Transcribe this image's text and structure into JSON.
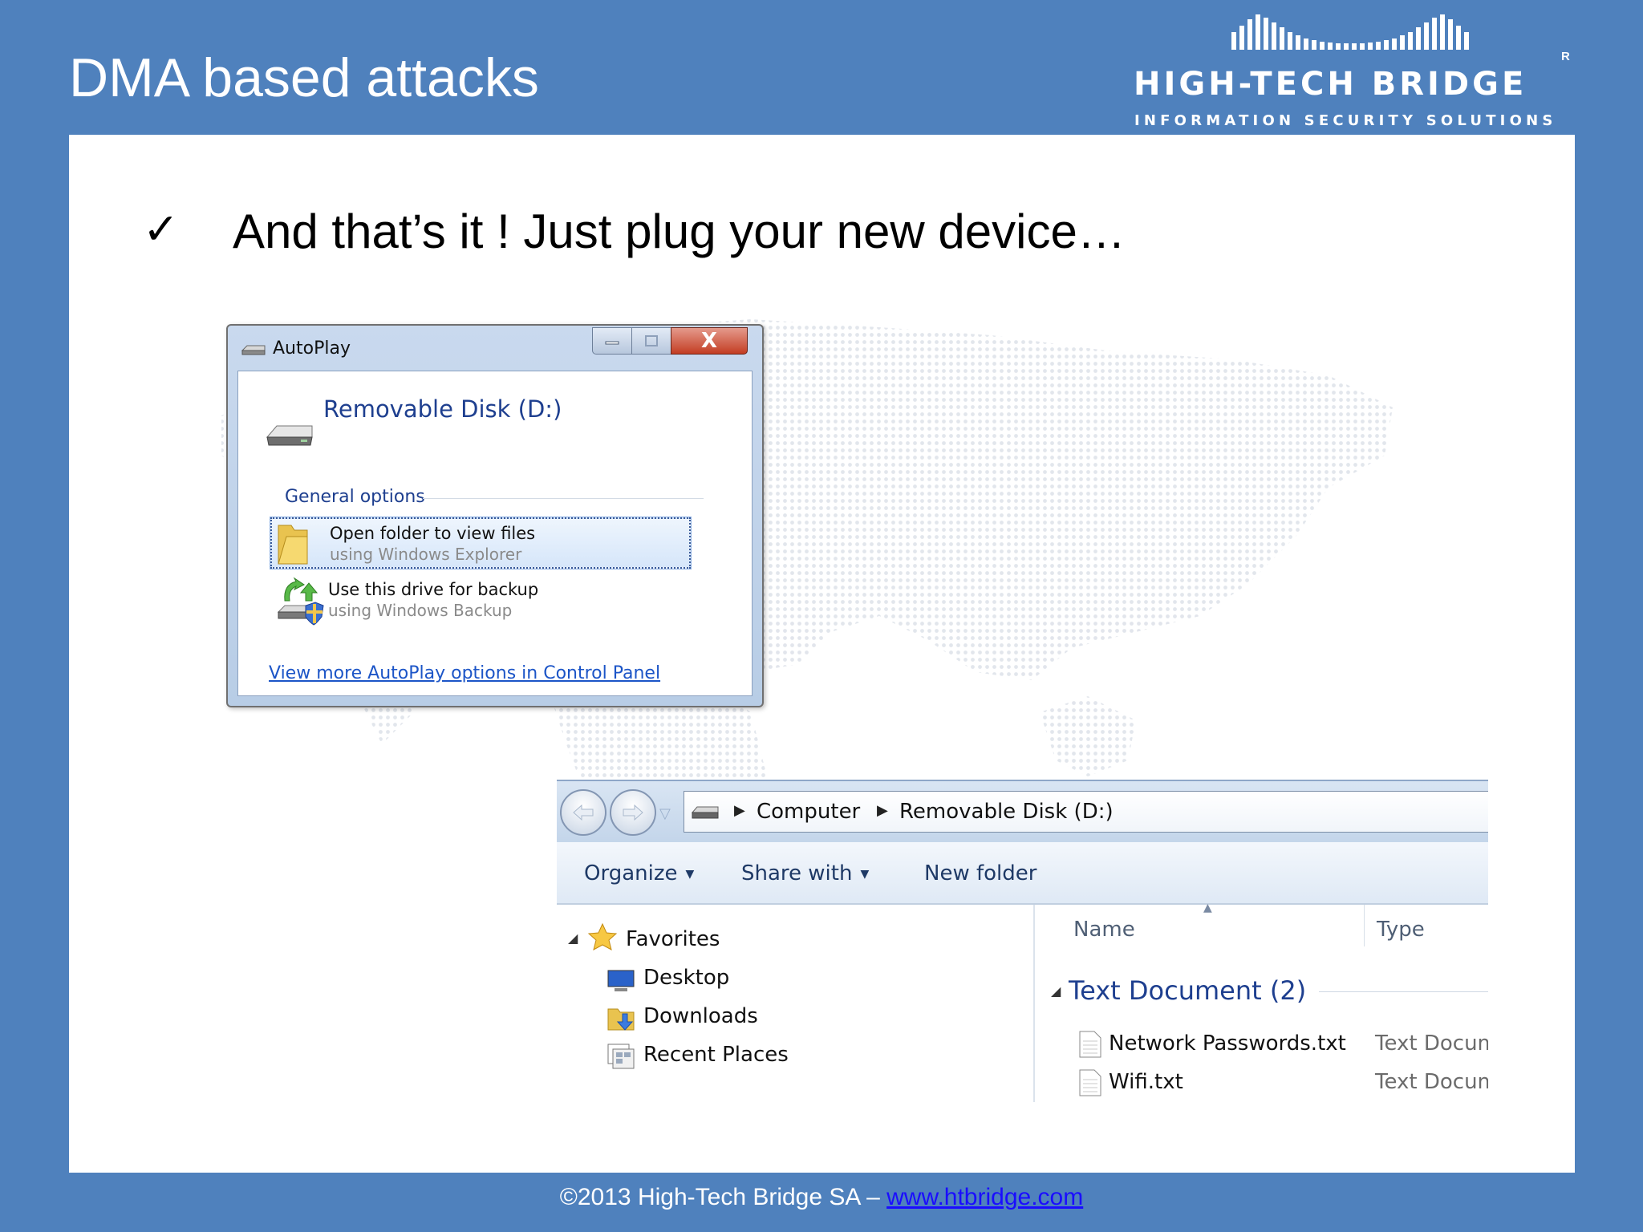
{
  "slide": {
    "title": "DMA based attacks",
    "bullet_mark": "✓",
    "bullet_text": "And that’s it ! Just plug your new device…"
  },
  "logo": {
    "name": "HIGH-TECH BRIDGE",
    "registered": "R",
    "tagline": "INFORMATION SECURITY SOLUTIONS"
  },
  "autoplay": {
    "title": "AutoPlay",
    "close_glyph": "X",
    "device": "Removable Disk (D:)",
    "section": "General options",
    "options": [
      {
        "main": "Open folder to view files",
        "sub": "using Windows Explorer",
        "selected": true,
        "icon": "folder-icon"
      },
      {
        "main": "Use this drive for backup",
        "sub": "using Windows Backup",
        "selected": false,
        "icon": "backup-icon"
      }
    ],
    "link": "View more AutoPlay options in Control Panel"
  },
  "explorer": {
    "breadcrumbs": [
      "Computer",
      "Removable Disk (D:)"
    ],
    "toolbar": {
      "organize": "Organize",
      "share": "Share with",
      "new_folder": "New folder"
    },
    "nav": {
      "favorites": "Favorites",
      "items": [
        "Desktop",
        "Downloads",
        "Recent Places"
      ]
    },
    "columns": {
      "name": "Name",
      "type": "Type"
    },
    "group": "Text Document (2)",
    "files": [
      {
        "name": "Network Passwords.txt",
        "type": "Text Document"
      },
      {
        "name": "Wifi.txt",
        "type": "Text Document"
      }
    ]
  },
  "footer": {
    "text": "©2013 High-Tech Bridge SA – ",
    "link": "www.htbridge.com"
  },
  "colors": {
    "slide_bg": "#4f81bd",
    "link_blue": "#1c55c7",
    "heading_blue": "#1e3f8f"
  }
}
